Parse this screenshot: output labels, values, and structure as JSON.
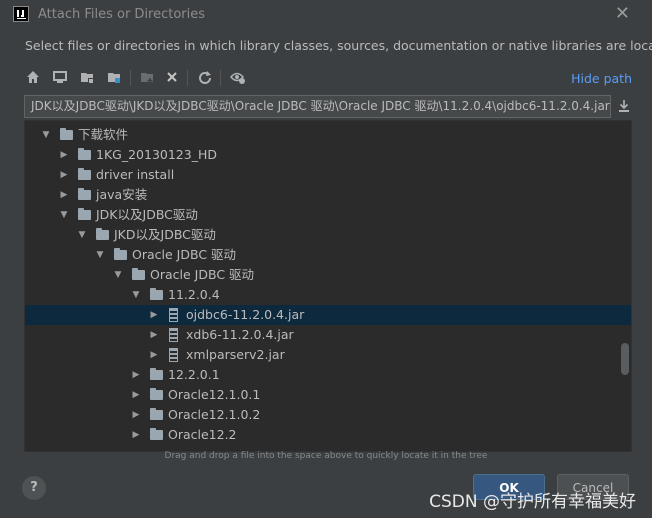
{
  "dialog": {
    "title": "Attach Files or Directories",
    "description": "Select files or directories in which library classes, sources, documentation or native libraries are located"
  },
  "toolbar": {
    "icons": [
      "home-icon",
      "desktop-icon",
      "project-folder-icon",
      "module-folder-icon",
      "new-folder-icon",
      "delete-icon",
      "refresh-icon",
      "show-hidden-icon"
    ],
    "hide_path_label": "Hide path"
  },
  "path_field": {
    "value": "JDK以及JDBC驱动\\JKD以及JDBC驱动\\Oracle JDBC 驱动\\Oracle JDBC 驱动\\11.2.0.4\\ojdbc6-11.2.0.4.jar"
  },
  "tree": {
    "items": [
      {
        "label": "下载软件",
        "expanded": true,
        "type": "folder",
        "selected": false
      },
      {
        "label": "1KG_20130123_HD",
        "expanded": false,
        "type": "folder",
        "selected": false
      },
      {
        "label": "driver install",
        "expanded": false,
        "type": "folder",
        "selected": false
      },
      {
        "label": "java安装",
        "expanded": false,
        "type": "folder",
        "selected": false
      },
      {
        "label": "JDK以及JDBC驱动",
        "expanded": true,
        "type": "folder",
        "selected": false
      },
      {
        "label": "JKD以及JDBC驱动",
        "expanded": true,
        "type": "folder",
        "selected": false
      },
      {
        "label": "Oracle JDBC 驱动",
        "expanded": true,
        "type": "folder",
        "selected": false
      },
      {
        "label": "Oracle JDBC 驱动",
        "expanded": true,
        "type": "folder",
        "selected": false
      },
      {
        "label": "11.2.0.4",
        "expanded": true,
        "type": "folder",
        "selected": false
      },
      {
        "label": "ojdbc6-11.2.0.4.jar",
        "expanded": false,
        "type": "jar",
        "selected": true
      },
      {
        "label": "xdb6-11.2.0.4.jar",
        "expanded": false,
        "type": "jar",
        "selected": false
      },
      {
        "label": "xmlparserv2.jar",
        "expanded": false,
        "type": "jar",
        "selected": false
      },
      {
        "label": "12.2.0.1",
        "expanded": false,
        "type": "folder",
        "selected": false
      },
      {
        "label": "Oracle12.1.0.1",
        "expanded": false,
        "type": "folder",
        "selected": false
      },
      {
        "label": "Oracle12.1.0.2",
        "expanded": false,
        "type": "folder",
        "selected": false
      },
      {
        "label": "Oracle12.2",
        "expanded": false,
        "type": "folder",
        "selected": false
      }
    ]
  },
  "hint": "Drag and drop a file into the space above to quickly locate it in the tree",
  "buttons": {
    "help": "?",
    "ok": "OK",
    "cancel": "Cancel"
  },
  "watermark": "CSDN @守护所有幸福美好"
}
